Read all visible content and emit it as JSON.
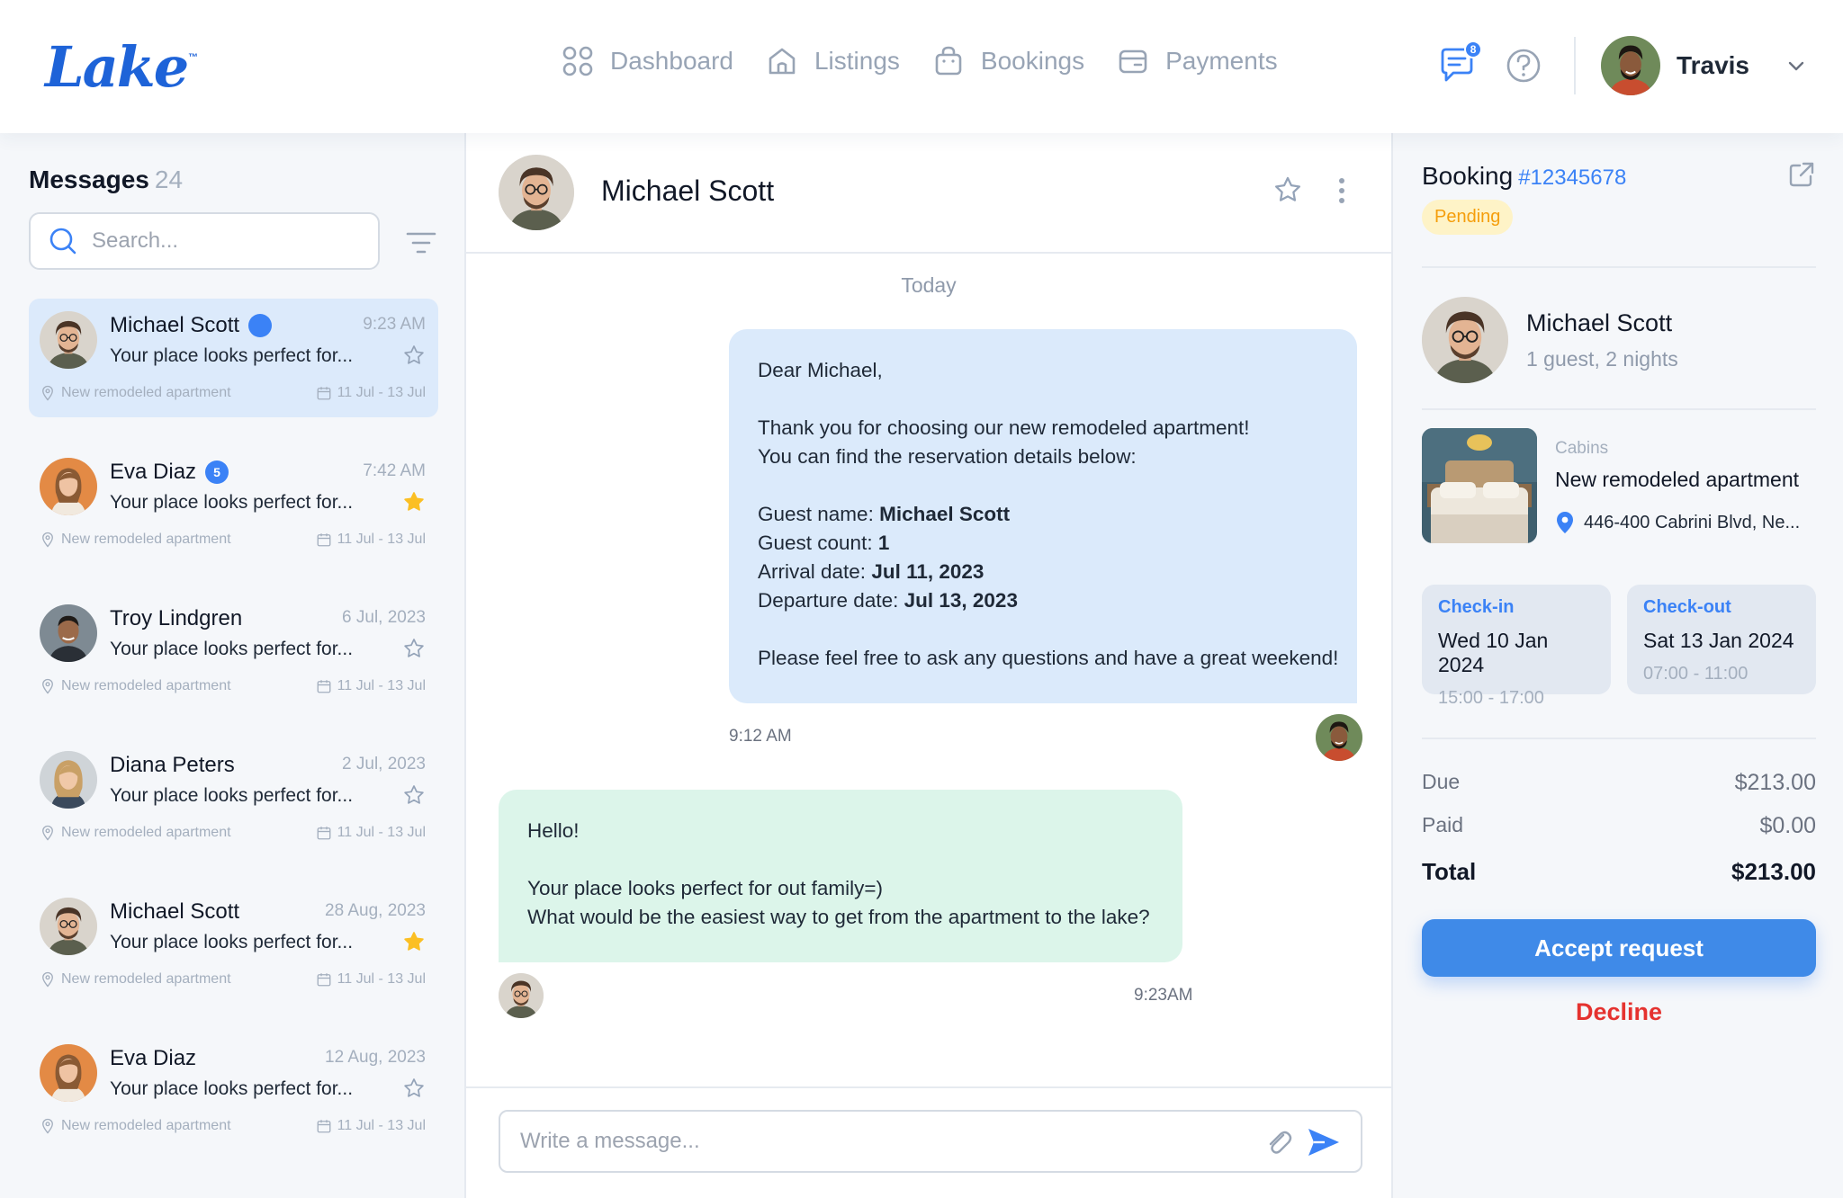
{
  "app": {
    "logo": "Lake",
    "logo_mark": "™"
  },
  "nav": [
    {
      "label": "Dashboard",
      "icon": "grid-icon"
    },
    {
      "label": "Listings",
      "icon": "home-icon"
    },
    {
      "label": "Bookings",
      "icon": "bag-icon"
    },
    {
      "label": "Payments",
      "icon": "wallet-icon"
    }
  ],
  "user": {
    "name": "Travis",
    "notifications": "8"
  },
  "messages": {
    "title": "Messages",
    "count": "24",
    "search_placeholder": "Search...",
    "conversations": [
      {
        "name": "Michael Scott",
        "time": "9:23 AM",
        "preview": "Your place looks perfect for...",
        "listing": "New remodeled apartment",
        "dates": "11 Jul - 13 Jul",
        "starred": false,
        "unread": "",
        "online": true,
        "active": true
      },
      {
        "name": "Eva Diaz",
        "time": "7:42 AM",
        "preview": "Your place looks perfect for...",
        "listing": "New remodeled apartment",
        "dates": "11 Jul - 13 Jul",
        "starred": true,
        "unread": "5",
        "online": false,
        "active": false
      },
      {
        "name": "Troy Lindgren",
        "time": "6 Jul, 2023",
        "preview": "Your place looks perfect for...",
        "listing": "New remodeled apartment",
        "dates": "11 Jul - 13 Jul",
        "starred": false,
        "unread": "",
        "online": false,
        "active": false
      },
      {
        "name": "Diana Peters",
        "time": "2 Jul, 2023",
        "preview": "Your place looks perfect for...",
        "listing": "New remodeled apartment",
        "dates": "11 Jul - 13 Jul",
        "starred": false,
        "unread": "",
        "online": false,
        "active": false
      },
      {
        "name": "Michael Scott",
        "time": "28 Aug, 2023",
        "preview": "Your place looks perfect for...",
        "listing": "New remodeled apartment",
        "dates": "11 Jul - 13 Jul",
        "starred": true,
        "unread": "",
        "online": false,
        "active": false
      },
      {
        "name": "Eva Diaz",
        "time": "12 Aug, 2023",
        "preview": "Your place looks perfect for...",
        "listing": "New remodeled apartment",
        "dates": "11 Jul - 13 Jul",
        "starred": false,
        "unread": "",
        "online": false,
        "active": false
      }
    ]
  },
  "chat": {
    "contact": "Michael Scott",
    "day_label": "Today",
    "outgoing": {
      "greeting": "Dear Michael,",
      "line1": "Thank you for choosing our new remodeled apartment!",
      "line2": "You can find the reservation details below:",
      "guest_name_label": "Guest name: ",
      "guest_name": "Michael Scott",
      "guest_count_label": "Guest count: ",
      "guest_count": "1",
      "arrival_label": "Arrival date: ",
      "arrival": "Jul 11, 2023",
      "departure_label": "Departure date: ",
      "departure": "Jul 13, 2023",
      "closing": "Please feel free to ask any questions and have a great weekend!",
      "time": "9:12 AM"
    },
    "incoming": {
      "line1": "Hello!",
      "line2": "Your place looks perfect for out family=)",
      "line3": "What would be the easiest way to get from the apartment to the lake?",
      "time": "9:23AM"
    },
    "composer_placeholder": "Write a message..."
  },
  "booking": {
    "title": "Booking",
    "id": "#12345678",
    "status": "Pending",
    "guest_name": "Michael Scott",
    "guest_summary": "1 guest, 2 nights",
    "category": "Cabins",
    "listing": "New remodeled apartment",
    "address": "446-400 Cabrini Blvd, Ne...",
    "checkin": {
      "label": "Check-in",
      "date": "Wed 10 Jan 2024",
      "time": "15:00 - 17:00"
    },
    "checkout": {
      "label": "Check-out",
      "date": "Sat 13 Jan 2024",
      "time": "07:00 - 11:00"
    },
    "due_label": "Due",
    "due": "$213.00",
    "paid_label": "Paid",
    "paid": "$0.00",
    "total_label": "Total",
    "total": "$213.00",
    "accept_label": "Accept request",
    "decline_label": "Decline"
  },
  "colors": {
    "accent": "#3b82f6",
    "decline": "#e5322f",
    "pending": "#f59e0b",
    "bubble_out": "#dbeafb",
    "bubble_in": "#dcf5ea"
  }
}
